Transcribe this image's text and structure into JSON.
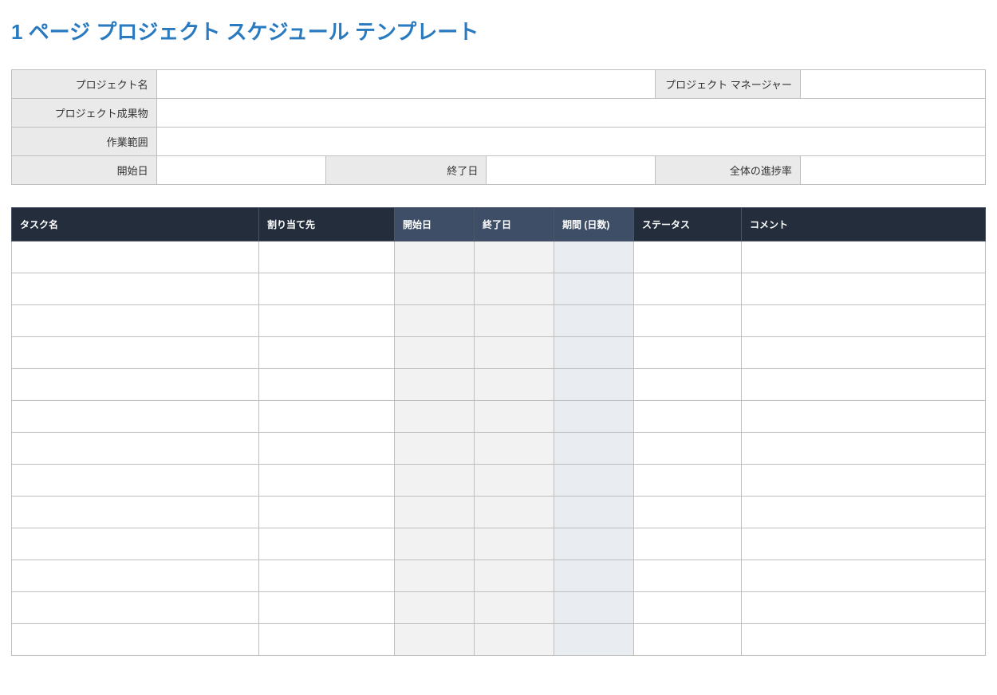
{
  "title": "1 ページ プロジェクト スケジュール テンプレート",
  "info": {
    "projectNameLabel": "プロジェクト名",
    "projectNameValue": "",
    "projectManagerLabel": "プロジェクト マネージャー",
    "projectManagerValue": "",
    "deliverablesLabel": "プロジェクト成果物",
    "deliverablesValue": "",
    "scopeLabel": "作業範囲",
    "scopeValue": "",
    "startDateLabel": "開始日",
    "startDateValue": "",
    "endDateLabel": "終了日",
    "endDateValue": "",
    "progressLabel": "全体の進捗率",
    "progressValue": ""
  },
  "taskTable": {
    "headers": {
      "taskName": "タスク名",
      "assignedTo": "割り当て先",
      "startDate": "開始日",
      "endDate": "終了日",
      "duration": "期間 (日数)",
      "status": "ステータス",
      "comment": "コメント"
    },
    "rows": [
      {
        "task": "",
        "assigned": "",
        "start": "",
        "end": "",
        "duration": "",
        "status": "",
        "comment": ""
      },
      {
        "task": "",
        "assigned": "",
        "start": "",
        "end": "",
        "duration": "",
        "status": "",
        "comment": ""
      },
      {
        "task": "",
        "assigned": "",
        "start": "",
        "end": "",
        "duration": "",
        "status": "",
        "comment": ""
      },
      {
        "task": "",
        "assigned": "",
        "start": "",
        "end": "",
        "duration": "",
        "status": "",
        "comment": ""
      },
      {
        "task": "",
        "assigned": "",
        "start": "",
        "end": "",
        "duration": "",
        "status": "",
        "comment": ""
      },
      {
        "task": "",
        "assigned": "",
        "start": "",
        "end": "",
        "duration": "",
        "status": "",
        "comment": ""
      },
      {
        "task": "",
        "assigned": "",
        "start": "",
        "end": "",
        "duration": "",
        "status": "",
        "comment": ""
      },
      {
        "task": "",
        "assigned": "",
        "start": "",
        "end": "",
        "duration": "",
        "status": "",
        "comment": ""
      },
      {
        "task": "",
        "assigned": "",
        "start": "",
        "end": "",
        "duration": "",
        "status": "",
        "comment": ""
      },
      {
        "task": "",
        "assigned": "",
        "start": "",
        "end": "",
        "duration": "",
        "status": "",
        "comment": ""
      },
      {
        "task": "",
        "assigned": "",
        "start": "",
        "end": "",
        "duration": "",
        "status": "",
        "comment": ""
      },
      {
        "task": "",
        "assigned": "",
        "start": "",
        "end": "",
        "duration": "",
        "status": "",
        "comment": ""
      },
      {
        "task": "",
        "assigned": "",
        "start": "",
        "end": "",
        "duration": "",
        "status": "",
        "comment": ""
      }
    ]
  }
}
